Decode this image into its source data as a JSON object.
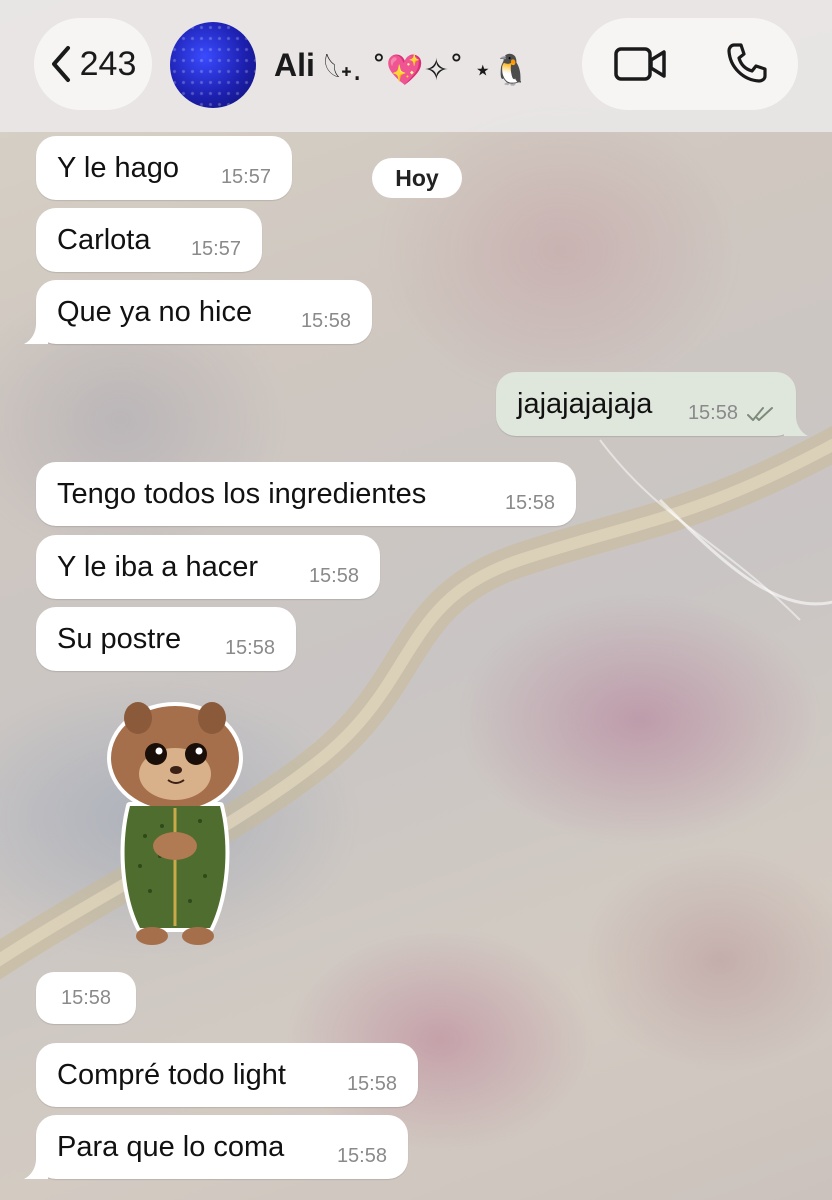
{
  "header": {
    "back_count": "243",
    "contact_name": "Ali",
    "contact_decoration": "𓆩˖. ˚💖✧˚ ⋆🐧"
  },
  "date_separator": "Hoy",
  "messages": [
    {
      "text": "Y le hago",
      "time": "15:57",
      "direction": "in"
    },
    {
      "text": "Carlota",
      "time": "15:57",
      "direction": "in"
    },
    {
      "text": "Que ya no hice",
      "time": "15:58",
      "direction": "in"
    },
    {
      "text": "jajajajajaja",
      "time": "15:58",
      "direction": "out",
      "status": "read"
    },
    {
      "text": "Tengo todos los ingredientes",
      "time": "15:58",
      "direction": "in"
    },
    {
      "text": "Y le iba a hacer",
      "time": "15:58",
      "direction": "in"
    },
    {
      "text": "Su postre",
      "time": "15:58",
      "direction": "in"
    },
    {
      "text": "Compré todo light",
      "time": "15:58",
      "direction": "in"
    },
    {
      "text": "Para que lo coma",
      "time": "15:58",
      "direction": "in"
    }
  ],
  "sticker": {
    "icon": "chipmunk-sticker",
    "time": "15:58"
  },
  "colors": {
    "incoming_bubble": "#ffffff",
    "outgoing_bubble": "#dfe7dc",
    "header_bg": "#e8e6e5",
    "time_text": "#8a8a8a"
  }
}
